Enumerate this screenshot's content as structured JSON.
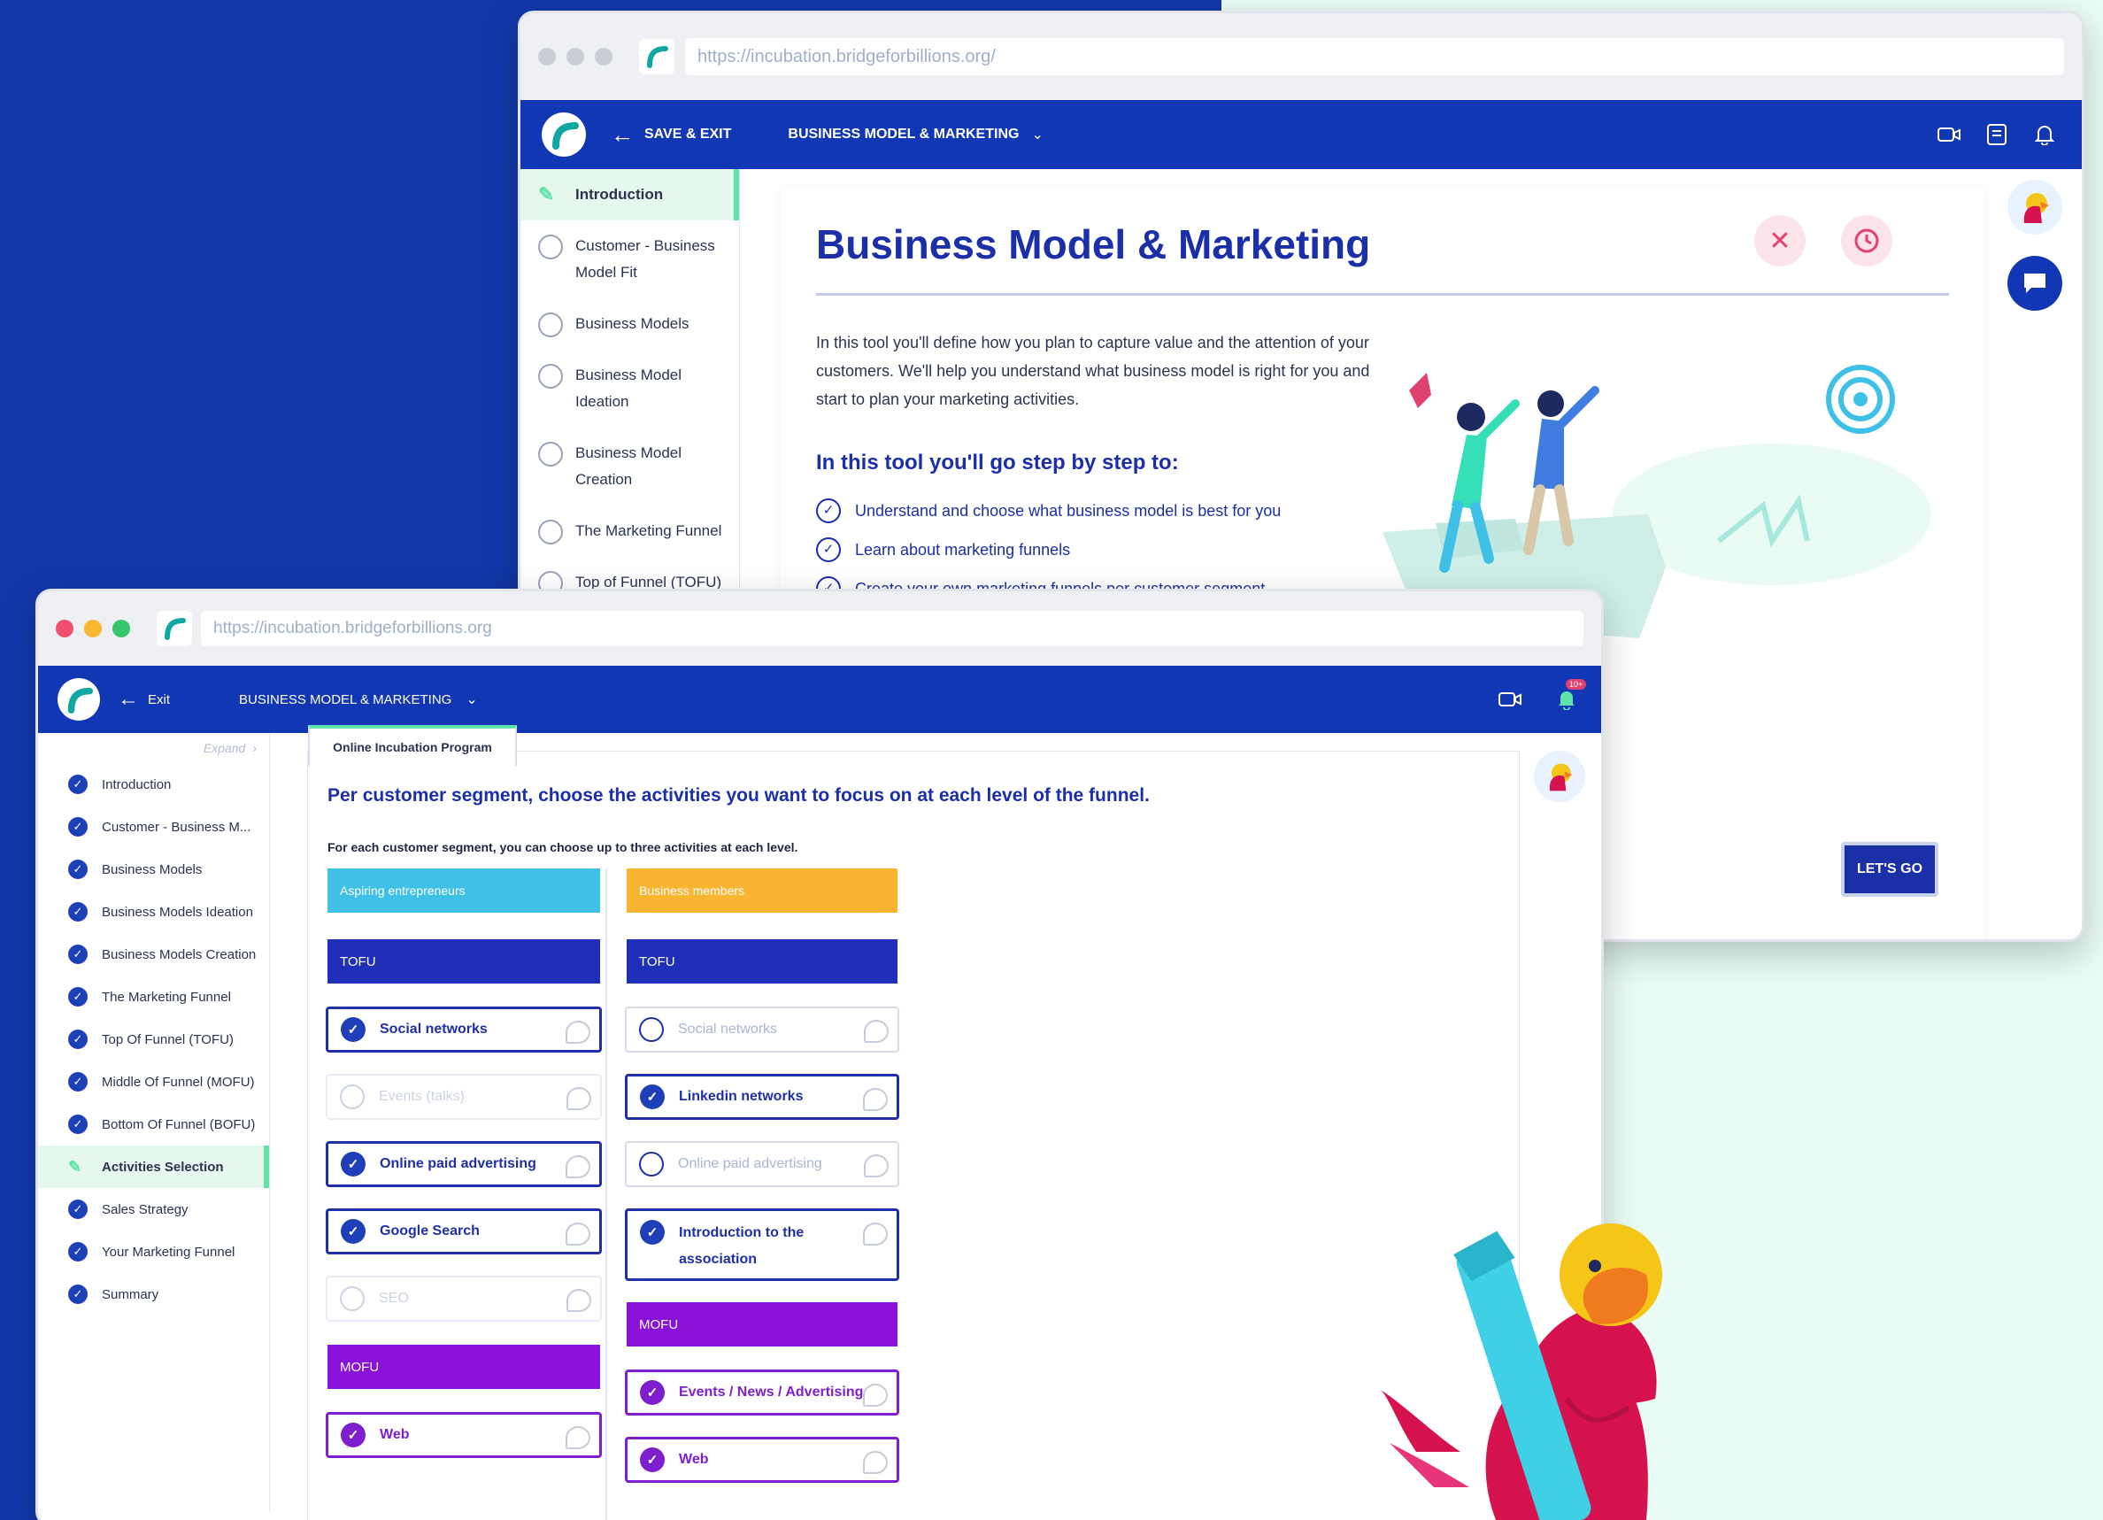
{
  "back_window": {
    "url": "https://incubation.bridgeforbillions.org/",
    "topbar": {
      "save_exit": "SAVE & EXIT",
      "module": "BUSINESS MODEL & MARKETING"
    },
    "sidebar": [
      {
        "label": "Introduction",
        "state": "active"
      },
      {
        "label": "Customer - Business Model Fit",
        "state": "todo"
      },
      {
        "label": "Business Models",
        "state": "todo"
      },
      {
        "label": "Business Model Ideation",
        "state": "todo"
      },
      {
        "label": "Business Model Creation",
        "state": "todo"
      },
      {
        "label": "The Marketing Funnel",
        "state": "todo"
      },
      {
        "label": "Top of Funnel (TOFU)",
        "state": "todo"
      }
    ],
    "content": {
      "title": "Business Model & Marketing",
      "intro": "In this tool you'll define how you plan to capture value and the attention of your customers. We'll help you understand what business model is right for you and start to plan your marketing activities.",
      "steps_heading": "In this tool you'll go step by step to:",
      "steps": [
        "Understand and choose what business model is best for you",
        "Learn about marketing funnels",
        "Create your own marketing funnels per customer segment"
      ],
      "cta": "LET'S GO"
    }
  },
  "front_window": {
    "url": "https://incubation.bridgeforbillions.org",
    "topbar": {
      "exit": "Exit",
      "module": "BUSINESS MODEL & MARKETING",
      "notif_count": "10+"
    },
    "sidebar": {
      "expand": "Expand",
      "items": [
        {
          "label": "Introduction",
          "state": "done"
        },
        {
          "label": "Customer - Business M...",
          "state": "done"
        },
        {
          "label": "Business Models",
          "state": "done"
        },
        {
          "label": "Business Models Ideation",
          "state": "done"
        },
        {
          "label": "Business Models Creation",
          "state": "done"
        },
        {
          "label": "The Marketing Funnel",
          "state": "done"
        },
        {
          "label": "Top Of Funnel (TOFU)",
          "state": "done"
        },
        {
          "label": "Middle Of Funnel (MOFU)",
          "state": "done"
        },
        {
          "label": "Bottom Of Funnel (BOFU)",
          "state": "done"
        },
        {
          "label": "Activities Selection",
          "state": "active"
        },
        {
          "label": "Sales Strategy",
          "state": "done"
        },
        {
          "label": "Your Marketing Funnel",
          "state": "done"
        },
        {
          "label": "Summary",
          "state": "done"
        }
      ]
    },
    "tab": "Online Incubation Program",
    "heading": "Per customer segment, choose the activities you want to focus on at each level of the funnel.",
    "subheading": "For each customer segment, you can choose up to three activities at each level.",
    "segments": [
      {
        "name": "Aspiring entrepreneurs",
        "color": "#3fc0e6",
        "tofu_label": "TOFU",
        "tofu": [
          {
            "label": "Social networks",
            "selected": true
          },
          {
            "label": "Events (talks)",
            "selected": false
          },
          {
            "label": "Online paid advertising",
            "selected": true
          },
          {
            "label": "Google Search",
            "selected": true
          },
          {
            "label": "SEO",
            "selected": false
          }
        ],
        "mofu_label": "MOFU",
        "mofu": [
          {
            "label": "Web",
            "selected": true
          }
        ]
      },
      {
        "name": "Business members",
        "color": "#f9b431",
        "tofu_label": "TOFU",
        "tofu": [
          {
            "label": "Social networks",
            "selected": false
          },
          {
            "label": "Linkedin networks",
            "selected": true
          },
          {
            "label": "Online paid advertising",
            "selected": false
          },
          {
            "label": "Introduction to the association",
            "selected": true
          }
        ],
        "mofu_label": "MOFU",
        "mofu": [
          {
            "label": "Events / News / Advertising",
            "selected": true
          },
          {
            "label": "Web",
            "selected": true
          }
        ]
      }
    ]
  },
  "colors": {
    "brand_blue": "#1237b4",
    "tofu_bar": "#1f2fb8",
    "mofu_bar": "#8a12d8",
    "accent_green": "#5fe3a8"
  }
}
